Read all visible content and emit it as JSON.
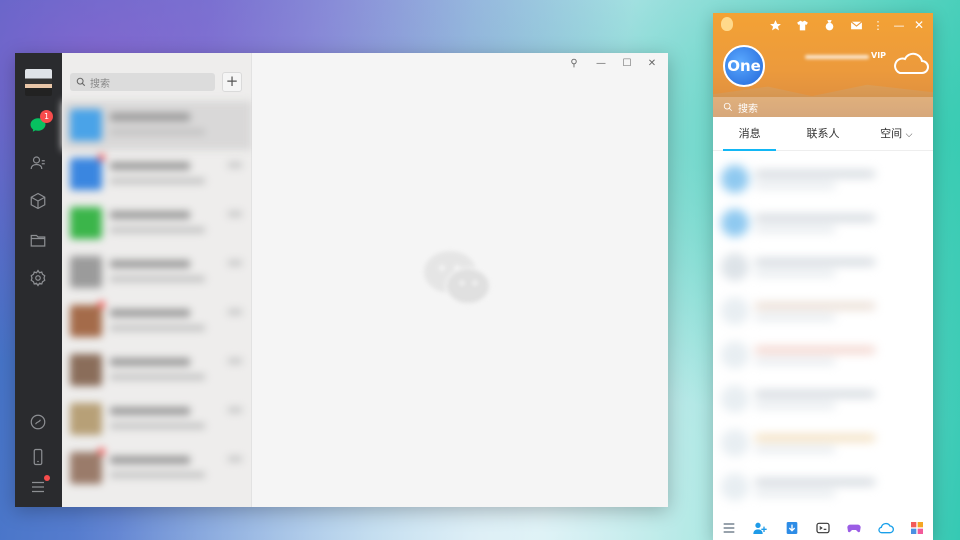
{
  "wechat": {
    "search_placeholder": "搜索",
    "unread_badge": "1",
    "window_controls": [
      "⚲",
      "—",
      "☐",
      "✕"
    ],
    "conversation_thumb_colors": [
      "#4aa3e8",
      "#3a86e0",
      "#3bb54a",
      "#9b9b9b",
      "#a46b4a",
      "#8a6d5a",
      "#b7a077",
      "#9a7b6a"
    ],
    "accent_color": "#07c160",
    "sidebar_icons": [
      "chat-icon",
      "contacts-icon",
      "favorites-icon",
      "folder-icon",
      "settings-icon",
      "miniprogram-icon",
      "phone-icon",
      "menu-icon"
    ]
  },
  "qq": {
    "avatar_text": "One",
    "vip_label": "VIP",
    "search_placeholder": "搜索",
    "tabs": [
      {
        "label": "消息"
      },
      {
        "label": "联系人"
      },
      {
        "label": "空间"
      }
    ],
    "accent_color": "#12b7f5",
    "header_color": "#f3a235",
    "top_icons": [
      "star-icon",
      "shirt-icon",
      "medal-icon",
      "mail-icon",
      "more-icon",
      "minimize-icon",
      "close-icon"
    ],
    "bottom_icons": [
      "main-menu-icon",
      "add-friend-icon",
      "file-transfer-icon",
      "mini-game-icon",
      "game-icon",
      "weiyun-icon",
      "apps-icon"
    ]
  }
}
